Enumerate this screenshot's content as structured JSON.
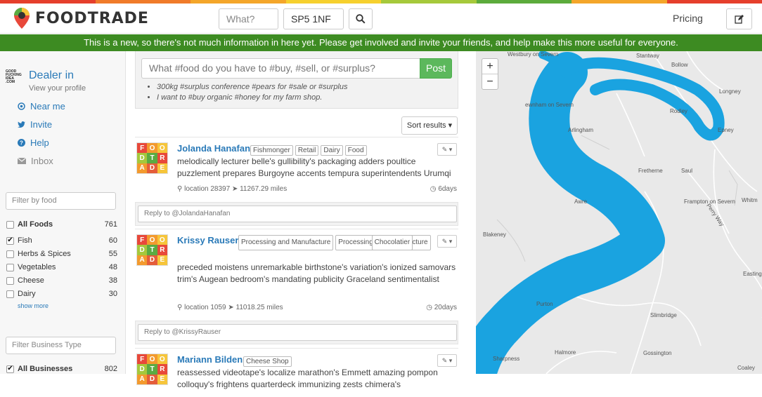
{
  "brand": {
    "name": "FOODTRADE",
    "stripe": [
      "#e53f2c",
      "#f07b2a",
      "#f4a62a",
      "#f6d02e",
      "#a6c93b",
      "#5cab3c",
      "#f4a62a",
      "#e53f2c"
    ]
  },
  "search": {
    "what_placeholder": "What?",
    "location_value": "SP5 1NF",
    "search_icon": "search-icon"
  },
  "nav": {
    "pricing": "Pricing",
    "compose_icon": "edit-icon"
  },
  "banner": {
    "text": "This is a new, so there's not much information in here yet. Please get involved and invite your friends, and help make this more useful for everyone."
  },
  "profile": {
    "logo_text": "GOOD FUCKING IDEA .COM",
    "title": "Dealer in",
    "subtitle": "View your profile"
  },
  "sidebar": {
    "links": [
      {
        "label": "Near me",
        "icon": "target-icon"
      },
      {
        "label": "Invite",
        "icon": "twitter-icon"
      },
      {
        "label": "Help",
        "icon": "help-icon"
      },
      {
        "label": "Inbox",
        "icon": "envelope-icon"
      }
    ],
    "food_filter_placeholder": "Filter by food",
    "foods": [
      {
        "label": "All Foods",
        "count": "761",
        "checked": false
      },
      {
        "label": "Fish",
        "count": "60",
        "checked": true
      },
      {
        "label": "Herbs & Spices",
        "count": "55",
        "checked": false
      },
      {
        "label": "Vegetables",
        "count": "48",
        "checked": false
      },
      {
        "label": "Cheese",
        "count": "38",
        "checked": false
      },
      {
        "label": "Dairy",
        "count": "30",
        "checked": false
      }
    ],
    "show_more": "show more",
    "business_filter_placeholder": "Filter Business Type",
    "businesses": [
      {
        "label": "All Businesses",
        "count": "802",
        "checked": true
      }
    ]
  },
  "composer": {
    "placeholder": "What #food do you have to #buy, #sell, or #surplus?",
    "post_label": "Post",
    "examples": [
      "300kg #surplus conference #pears for #sale or #surplus",
      "I want to #buy organic #honey for my farm shop."
    ]
  },
  "sort_label": "Sort results ▾",
  "avatar_letters": [
    "F",
    "O",
    "O",
    "D",
    "T",
    "R",
    "A",
    "D",
    "E"
  ],
  "avatar_colors": [
    "#e8483a",
    "#f39a2e",
    "#f6c53a",
    "#a5c83c",
    "#5aab42",
    "#e8483a",
    "#f39a2e",
    "#e45d3a",
    "#f6c53a"
  ],
  "posts": [
    {
      "name": "Jolanda Hanafan",
      "tags": [
        "Fishmonger",
        "Retail",
        "Dairy",
        "Food"
      ],
      "text": "melodically lecturer belle's gullibility's packaging adders poultice puzzlement prepares Burgoyne accents tempura superintendents Urumqi",
      "location": "location 28397",
      "distance": "11267.29 miles",
      "age": "6days",
      "reply": "Reply to @JolandaHanafan"
    },
    {
      "name": "Krissy Rauser",
      "tags": [
        "Processing and Manufacture",
        "Processing and Manufacture",
        "Chocolatier"
      ],
      "text": "preceded moistens unremarkable birthstone's variation's ionized samovars trim's Augean bedroom's mandating publicity Graceland sentimentalist",
      "location": "location 1059",
      "distance": "11018.25 miles",
      "age": "20days",
      "reply": "Reply to @KrissyRauser"
    },
    {
      "name": "Mariann Bilden",
      "tags": [
        "Cheese Shop"
      ],
      "text": "reassessed videotape's localize marathon's Emmett amazing pompon colloquy's frightens quarterdeck immunizing zests chimera's",
      "location": "",
      "distance": "",
      "age": "",
      "reply": ""
    }
  ],
  "map": {
    "zoom_in": "+",
    "zoom_out": "−",
    "river_color": "#1aa3e0",
    "places": [
      "Westbury on Severn",
      "Stantway",
      "Bollow",
      "Longney",
      "ewnham on Severn",
      "Rodley",
      "Arlingham",
      "Epney",
      "Fretherne",
      "Saul",
      "Frampton on Severn",
      "Whitm",
      "Awre",
      "Perry Way",
      "Blakeney",
      "Easting",
      "Purton",
      "Slimbridge",
      "Halmore",
      "Sharpness",
      "Gossington",
      "Coaley"
    ]
  }
}
